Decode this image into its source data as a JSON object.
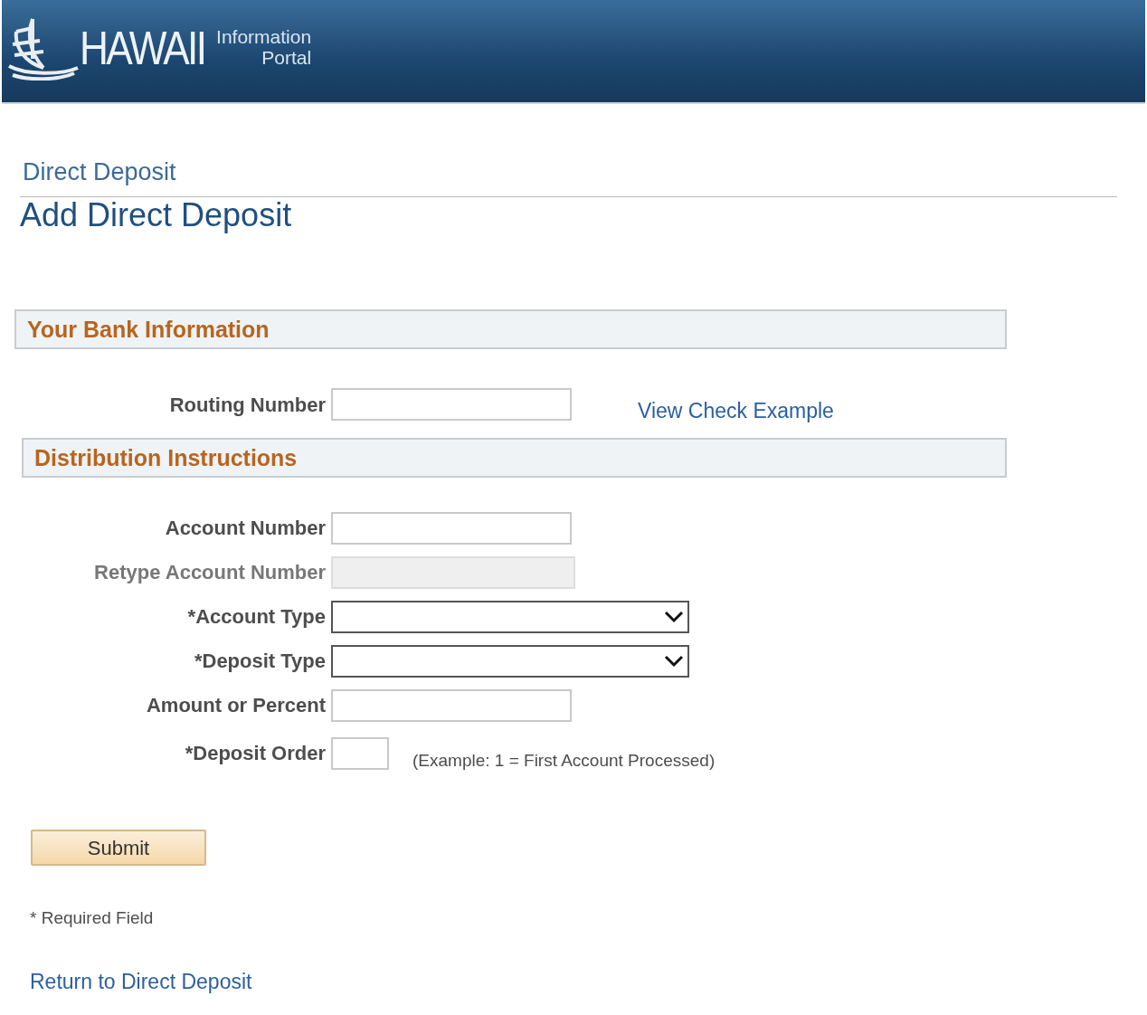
{
  "header": {
    "logo_text": "HAWAII",
    "logo_subtitle_top": "Information",
    "logo_subtitle_bottom": "Portal"
  },
  "breadcrumb": "Direct Deposit",
  "page_title": "Add Direct Deposit",
  "sections": [
    {
      "title": "Your Bank Information",
      "fields": [
        {
          "label": "Routing Number",
          "kind": "text",
          "disabled": false,
          "link": "View Check Example"
        }
      ]
    },
    {
      "title": "Distribution Instructions",
      "fields": [
        {
          "label": "Account Number",
          "kind": "text",
          "disabled": false
        },
        {
          "label": "Retype Account Number",
          "kind": "text",
          "disabled": true
        },
        {
          "label": "*Account Type",
          "kind": "select",
          "disabled": false
        },
        {
          "label": "*Deposit Type",
          "kind": "select",
          "disabled": false
        },
        {
          "label": "Amount or Percent",
          "kind": "text",
          "disabled": false
        },
        {
          "label": "*Deposit Order",
          "kind": "short",
          "disabled": false,
          "note": "(Example: 1 = First Account Processed)"
        }
      ]
    }
  ],
  "submit_button": "Submit",
  "required_note": "* Required Field",
  "return_link": "Return to Direct Deposit"
}
